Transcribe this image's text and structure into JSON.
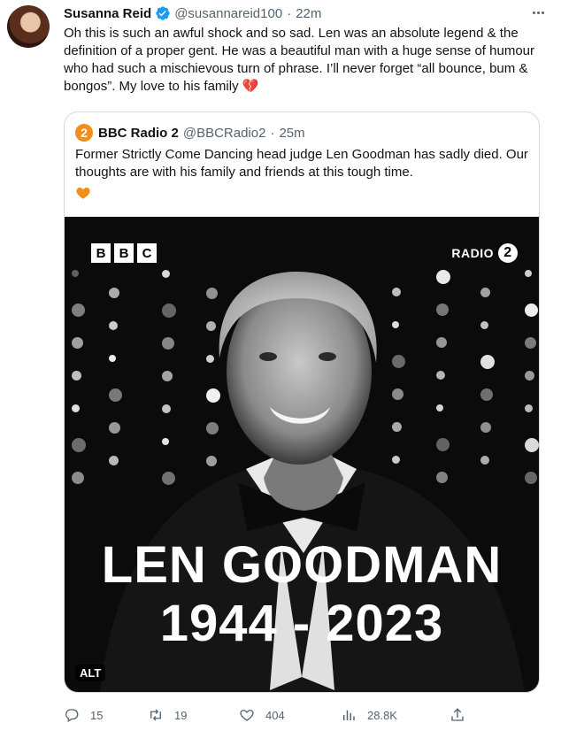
{
  "tweet": {
    "name": "Susanna Reid",
    "handle": "@susannareid100",
    "separator": "·",
    "time": "22m",
    "text": "Oh this is such an awful shock and so sad. Len was an absolute legend & the definition of a proper gent. He was a beautiful man with a huge sense of humour who had such a mischievous turn of phrase. I’ll never forget “all bounce, bum & bongos”. My love to his family 💔"
  },
  "quote": {
    "avatar_label": "2",
    "name": "BBC Radio 2",
    "handle": "@BBCRadio2",
    "separator": "·",
    "time": "25m",
    "text": "Former Strictly Come Dancing head judge Len Goodman has sadly died. Our thoughts are with his family and friends at this tough time.",
    "media": {
      "bbc_letters": [
        "B",
        "B",
        "C"
      ],
      "radio_label": "RADIO",
      "radio_number": "2",
      "headline": "LEN GOODMAN",
      "years": "1944 - 2023",
      "alt_badge": "ALT"
    }
  },
  "actions": {
    "replies": "15",
    "retweets": "19",
    "likes": "404",
    "views": "28.8K"
  },
  "colors": {
    "text": "#0f1419",
    "secondary": "#536471",
    "verified": "#1d9bf0",
    "radio2_orange": "#f18e1c",
    "border": "#cfd9de"
  }
}
